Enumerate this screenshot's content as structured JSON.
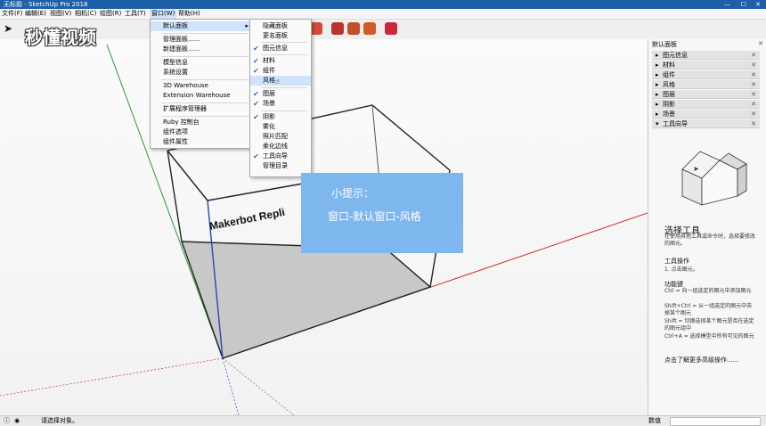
{
  "window": {
    "title": "无标题 - SketchUp Pro 2018"
  },
  "menubar": [
    "文件(F)",
    "编辑(E)",
    "视图(V)",
    "相机(C)",
    "绘图(R)",
    "工具(T)",
    "窗口(W)",
    "帮助(H)"
  ],
  "watermark": "秒懂视频",
  "window_menu": {
    "items": [
      {
        "label": "默认面板",
        "arrow": "▸"
      },
      {
        "label": "管理面板......"
      },
      {
        "label": "新建面板......"
      },
      {
        "label": "模型信息"
      },
      {
        "label": "系统设置"
      },
      {
        "label": "3D Warehouse"
      },
      {
        "label": "Extension Warehouse"
      },
      {
        "label": "扩展程序管理器"
      },
      {
        "label": "Ruby 控制台"
      },
      {
        "label": "组件选项"
      },
      {
        "label": "组件属性"
      }
    ]
  },
  "submenu": {
    "items": [
      {
        "label": "隐藏面板",
        "checked": false
      },
      {
        "label": "更名面板",
        "checked": false
      },
      {
        "label": "图元信息",
        "checked": true
      },
      {
        "label": "材料",
        "checked": true
      },
      {
        "label": "组件",
        "checked": true
      },
      {
        "label": "风格",
        "checked": false
      },
      {
        "label": "图层",
        "checked": true
      },
      {
        "label": "场景",
        "checked": true
      },
      {
        "label": "阴影",
        "checked": true
      },
      {
        "label": "雾化",
        "checked": false
      },
      {
        "label": "照片匹配",
        "checked": false
      },
      {
        "label": "柔化边线",
        "checked": false
      },
      {
        "label": "工具向导",
        "checked": true
      },
      {
        "label": "管理目录",
        "checked": false
      }
    ]
  },
  "tip": {
    "title": "小提示：",
    "body": "窗口-默认窗口-风格"
  },
  "model_label": "Makerbot Repli",
  "tray": {
    "title": "默认面板",
    "items": [
      "图元信息",
      "材料",
      "组件",
      "风格",
      "图层",
      "阴影",
      "场景",
      "工具向导"
    ],
    "instructor": {
      "title": "选择工具",
      "intro": "在使用其他工具或命令时，选择要修改的图元。",
      "ops_title": "工具操作",
      "ops": "1. 点击图元。",
      "keys_title": "功能键",
      "keys": [
        "Ctrl = 向一组选定的图元中添加图元",
        "Shift+Ctrl = 从一组选定的图元中去掉某个图元",
        "Shift = 切换选择某个图元是否在选定的图元组中",
        "Ctrl+A = 选择模型中所有可见的图元"
      ],
      "more": "点击了解更多高级操作......"
    }
  },
  "status": {
    "hint": "请选择对象。",
    "measure_label": "数值"
  },
  "colors": {
    "accent_blue": "#2b6fc4",
    "tip_bg": "#7eb6ee",
    "titlebar": "#1f5fa8"
  }
}
